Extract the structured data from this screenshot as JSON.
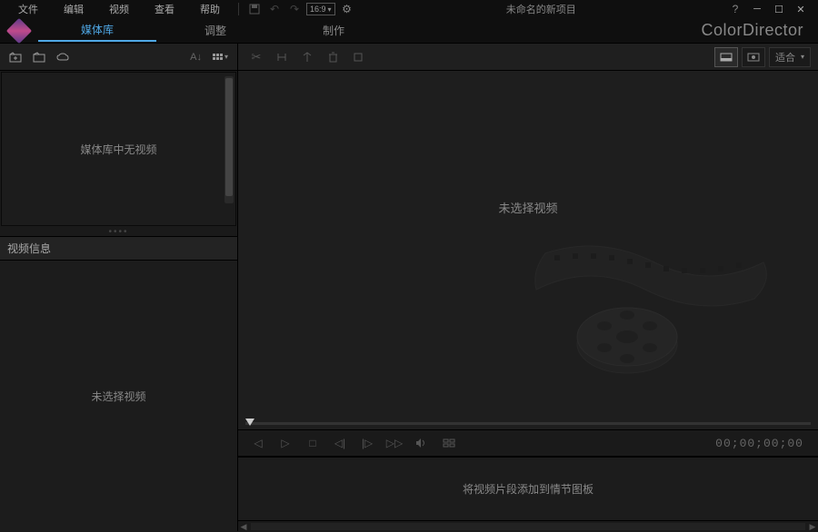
{
  "menu": {
    "file": "文件",
    "edit": "编辑",
    "video": "视频",
    "view": "查看",
    "help": "帮助"
  },
  "toolbar": {
    "ratio": "16:9"
  },
  "project_title": "未命名的新项目",
  "brand": "ColorDirector",
  "tabs": {
    "library": "媒体库",
    "adjust": "调整",
    "produce": "制作"
  },
  "left": {
    "sort_label": "A↓",
    "media_empty": "媒体库中无视频",
    "info_header": "视频信息",
    "info_empty": "未选择视频"
  },
  "right": {
    "fit_label": "适合",
    "preview_empty": "未选择视频",
    "timecode": "00;00;00;00",
    "storyboard_hint": "将视频片段添加到情节图板"
  }
}
